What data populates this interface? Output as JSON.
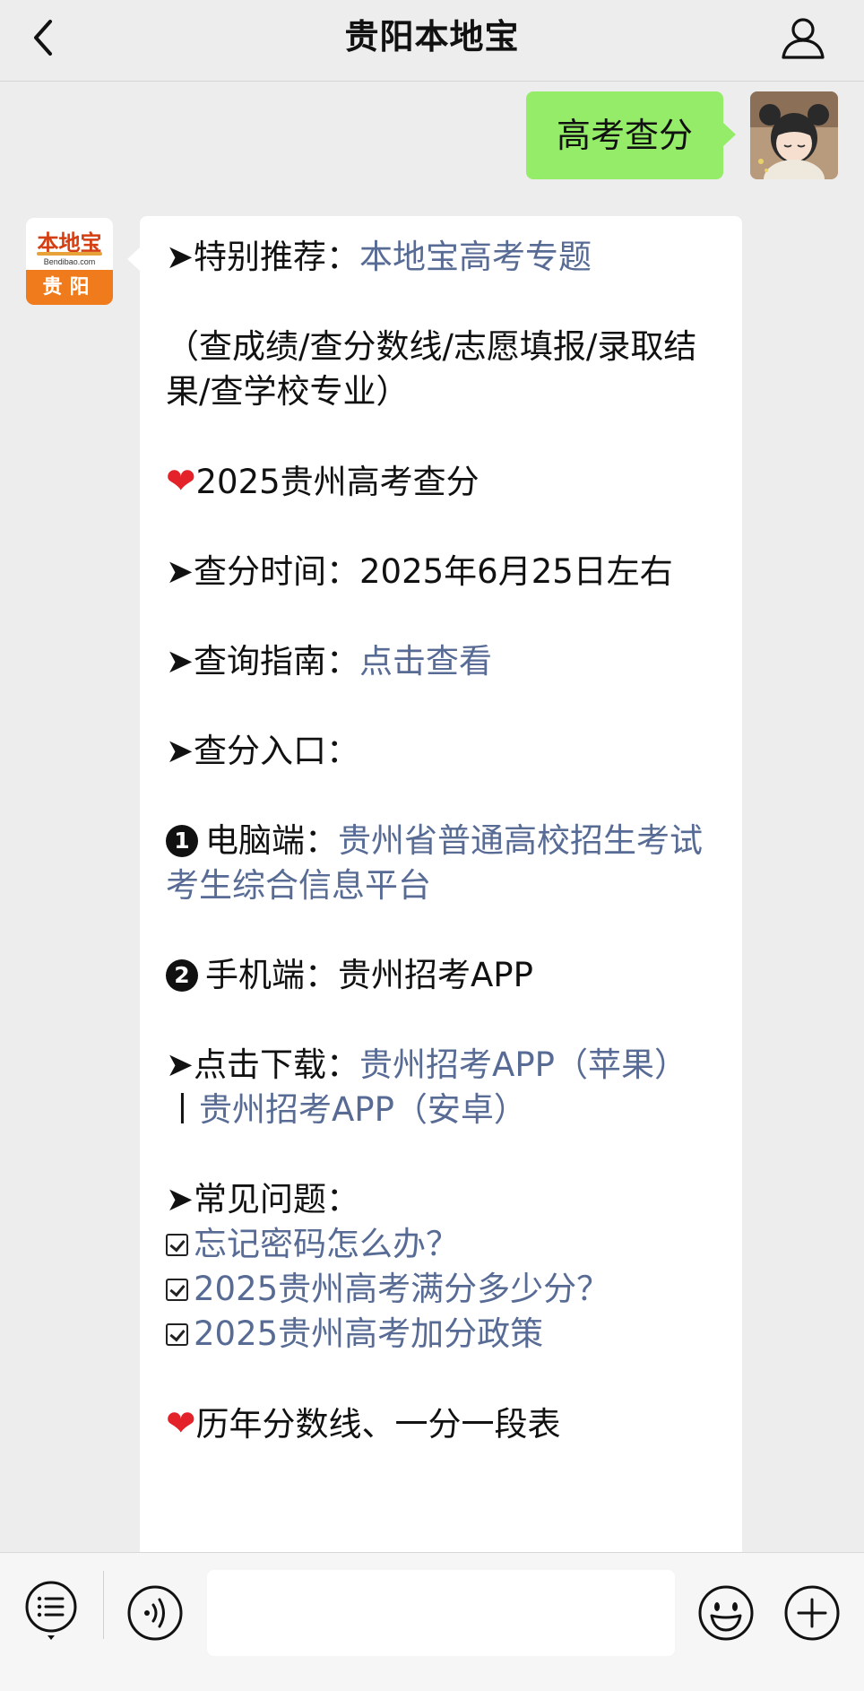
{
  "header": {
    "title": "贵阳本地宝",
    "back_icon": "chevron-left-icon",
    "profile_icon": "person-icon"
  },
  "user_message": {
    "text": "高考查分",
    "bubble_color": "#95ec69"
  },
  "bot": {
    "avatar": {
      "name": "本地宝",
      "domain": "Bendibao.com",
      "city": "贵阳"
    },
    "message": {
      "recommend_prefix": "➤特别推荐：",
      "recommend_link": "本地宝高考专题",
      "services": "（查成绩/查分数线/志愿填报/录取结果/查学校专业）",
      "section1_heading": "2025贵州高考查分",
      "time_label": "➤查分时间：",
      "time_value": "2025年6月25日左右",
      "guide_label": "➤查询指南：",
      "guide_link": "点击查看",
      "entry_label": "➤查分入口：",
      "pc_number": "1",
      "pc_label": "电脑端：",
      "pc_link": "贵州省普通高校招生考试考生综合信息平台",
      "mobile_number": "2",
      "mobile_label": "手机端：",
      "mobile_value": "贵州招考APP",
      "download_label": "➤点击下载：",
      "download_ios": "贵州招考APP（苹果）",
      "download_sep": "丨",
      "download_android": "贵州招考APP（安卓）",
      "faq_label": "➤常见问题：",
      "faq_items": [
        "忘记密码怎么办？",
        "2025贵州高考满分多少分？",
        "2025贵州高考加分政策"
      ],
      "section2_heading": "历年分数线、一分一段表"
    },
    "link_color": "#576b95"
  },
  "input_bar": {
    "menu_icon": "list-menu-icon",
    "voice_icon": "voice-icon",
    "input_value": "",
    "emoji_icon": "emoji-icon",
    "plus_icon": "plus-icon"
  }
}
